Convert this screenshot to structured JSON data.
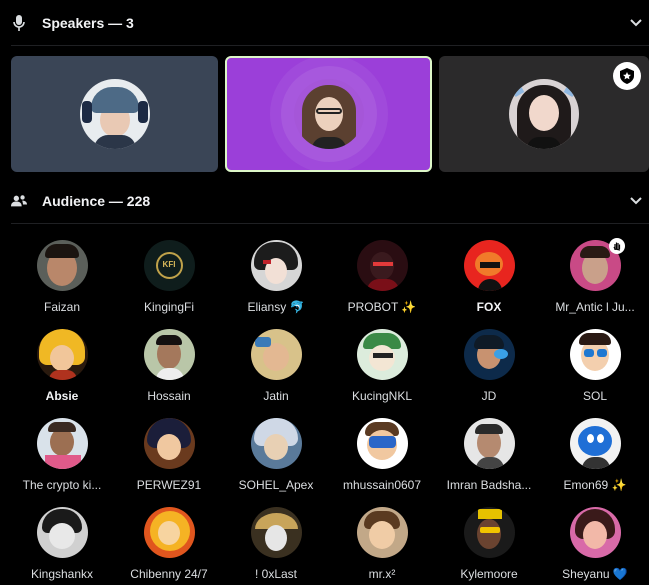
{
  "speakers": {
    "title": "Speakers — 3",
    "tiles": [
      {
        "name": "speaker-1",
        "bg": "#3a4556",
        "active": false
      },
      {
        "name": "speaker-2",
        "bg": "#9b3fd9",
        "active": true
      },
      {
        "name": "speaker-3",
        "bg": "#2b2a2b",
        "active": false
      }
    ]
  },
  "audience": {
    "title": "Audience — 228",
    "members": [
      {
        "name": "Faizan",
        "bold": false
      },
      {
        "name": "KingingFi",
        "bold": false
      },
      {
        "name": "Eliansy 🐬",
        "bold": false
      },
      {
        "name": "PROBOT ✨",
        "bold": false
      },
      {
        "name": "FOX",
        "bold": true
      },
      {
        "name": "Mr_Antic l Ju...",
        "bold": false
      },
      {
        "name": "Absie",
        "bold": true
      },
      {
        "name": "Hossain",
        "bold": false
      },
      {
        "name": "Jatin",
        "bold": false
      },
      {
        "name": "KucingNKL",
        "bold": false
      },
      {
        "name": "JD",
        "bold": false
      },
      {
        "name": "SOL",
        "bold": false
      },
      {
        "name": "The crypto ki...",
        "bold": false
      },
      {
        "name": "PERWEZ91",
        "bold": false
      },
      {
        "name": "SOHEL_Apex",
        "bold": false
      },
      {
        "name": "mhussain0607",
        "bold": false
      },
      {
        "name": "Imran Badsha...",
        "bold": false
      },
      {
        "name": "Emon69 ✨",
        "bold": false
      },
      {
        "name": "Kingshankx",
        "bold": false
      },
      {
        "name": "Chibenny 24/7",
        "bold": false
      },
      {
        "name": "! 0xLast",
        "bold": false
      },
      {
        "name": "mr.x²",
        "bold": false
      },
      {
        "name": "Kylemoore",
        "bold": false
      },
      {
        "name": "Sheyanu 💙",
        "bold": false
      }
    ]
  },
  "icons": {
    "speakers": "microphone-icon",
    "audience": "people-icon",
    "collapse": "chevron-down-icon",
    "moderator": "star-shield-icon",
    "raised_hand": "hand-icon"
  },
  "colors": {
    "active_border": "#ddf7c8",
    "text": "#dbdee1",
    "header_text": "#f2f3f5"
  }
}
